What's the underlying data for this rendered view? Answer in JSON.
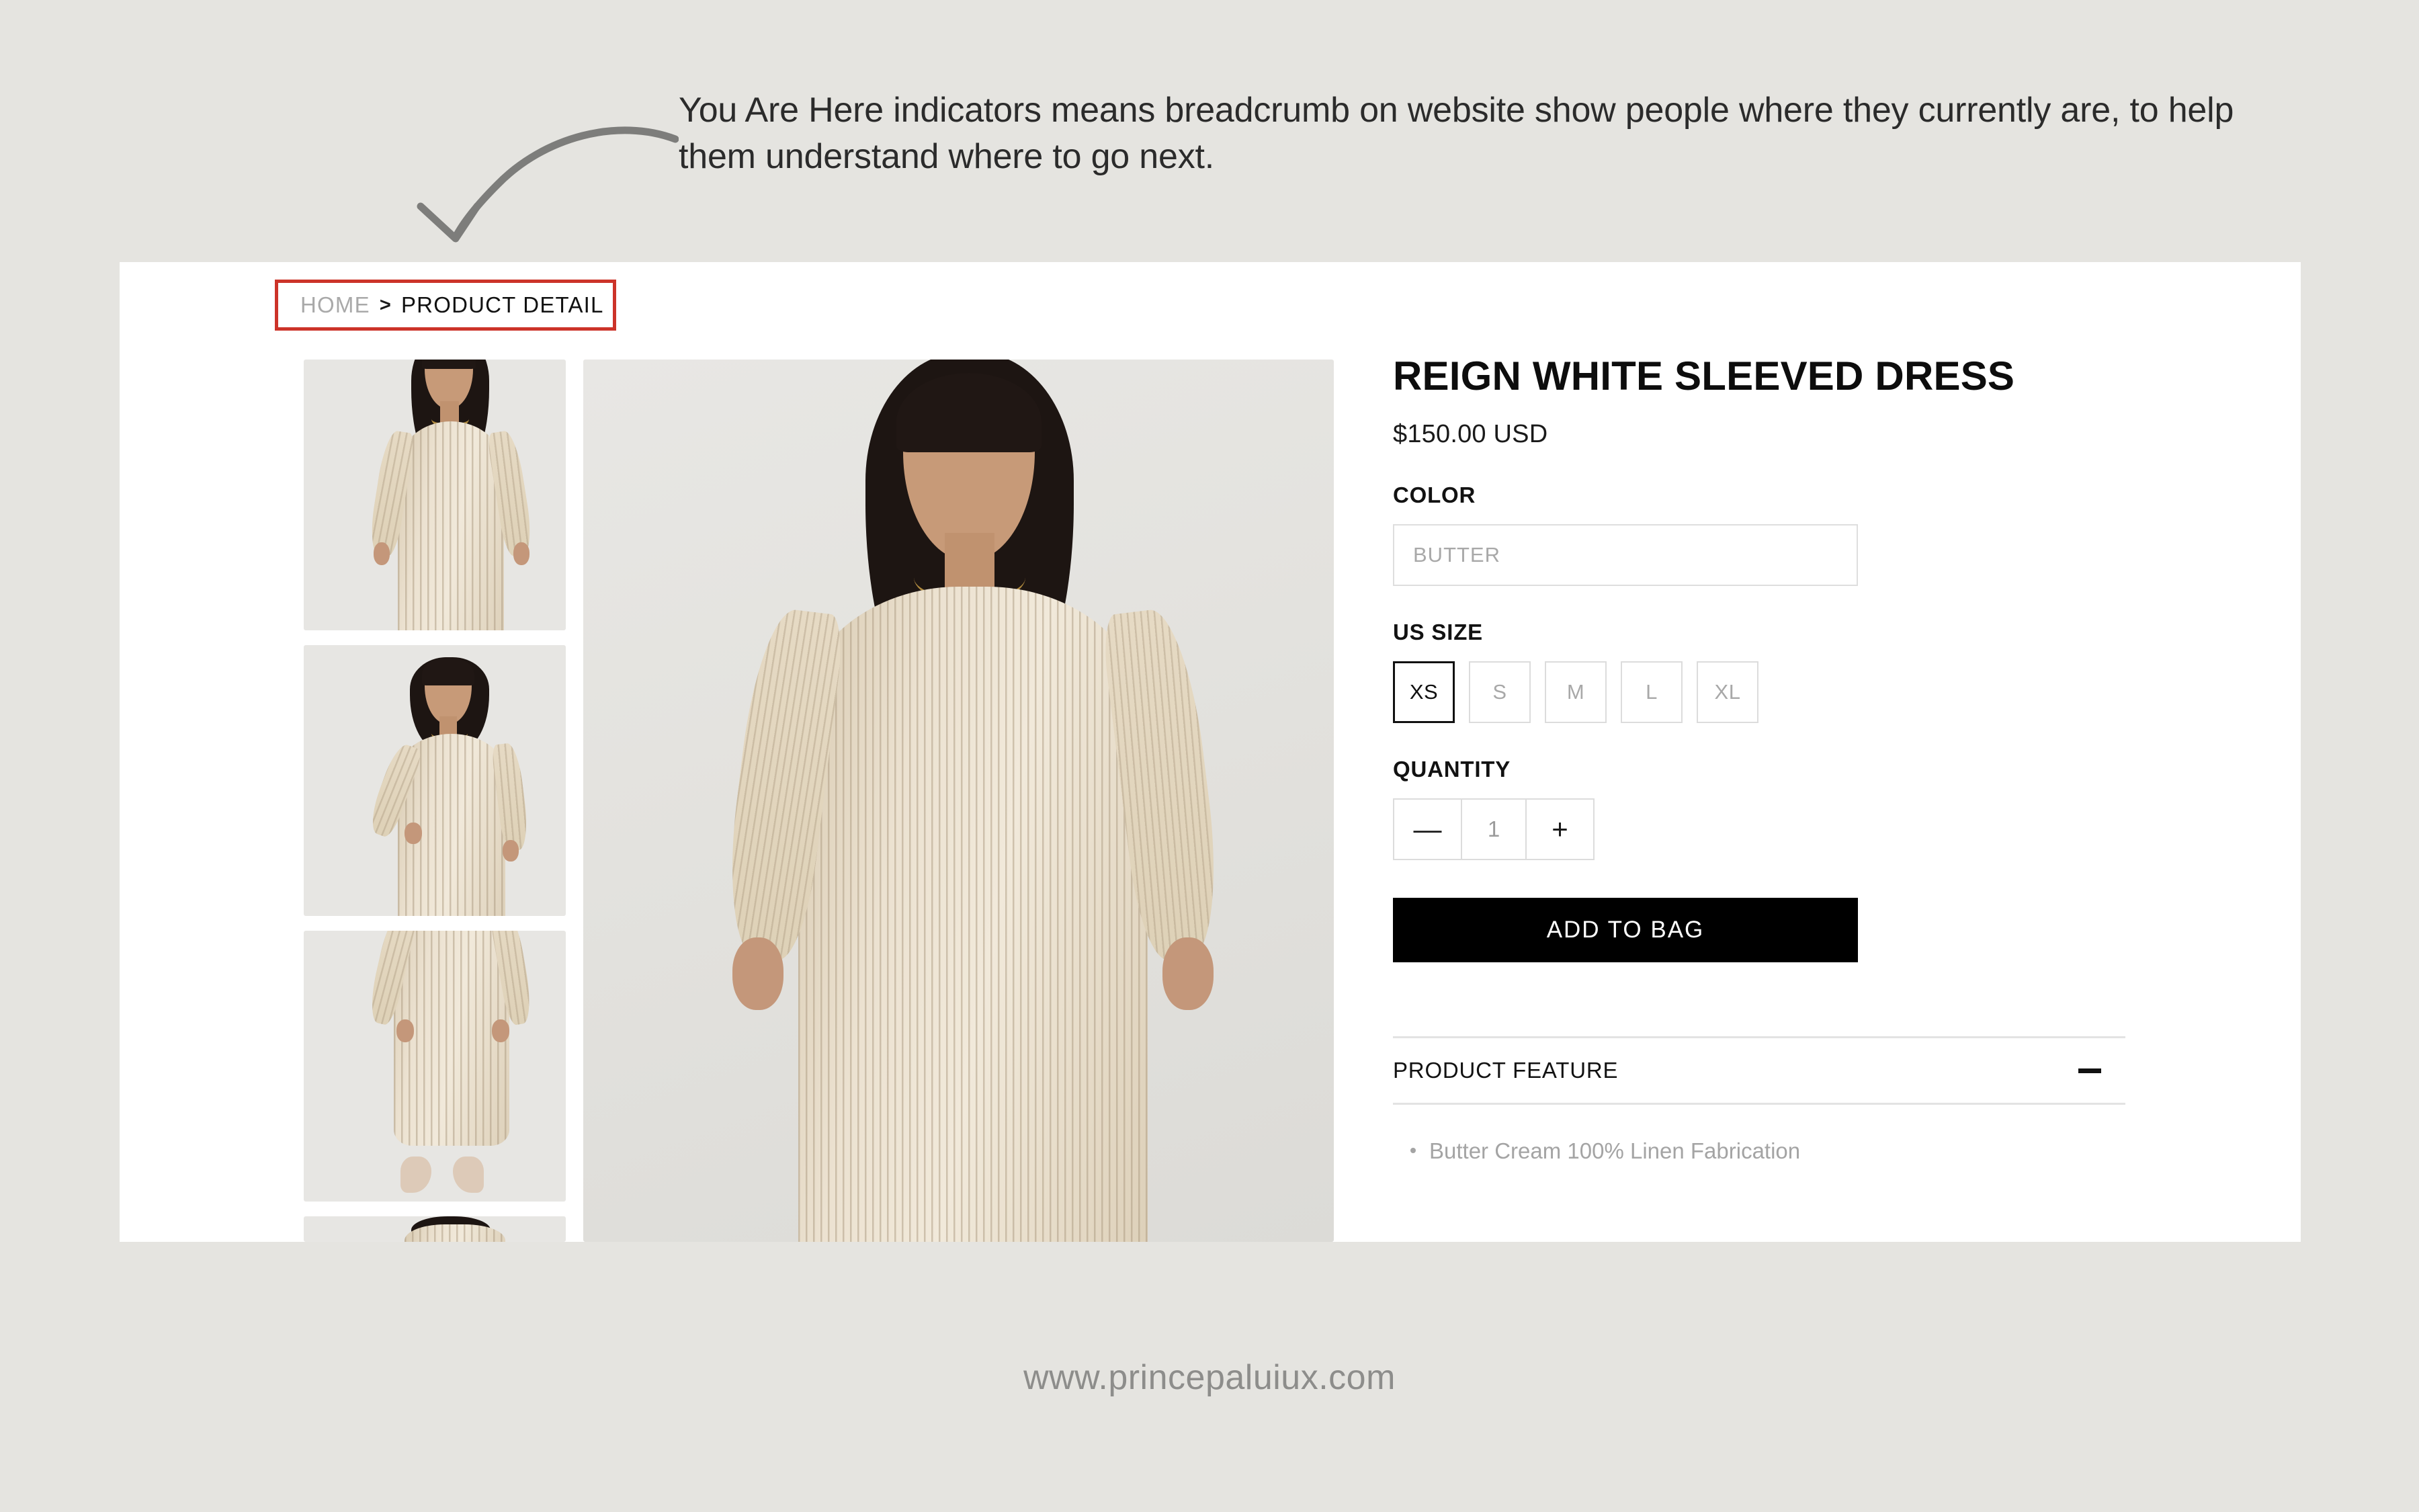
{
  "annotation": {
    "text": "You Are Here indicators means breadcrumb on website show people where they currently are, to help them understand where to go next.",
    "arrow_color": "#7d7d7b"
  },
  "highlight": {
    "color": "#cc3329"
  },
  "breadcrumb": {
    "home_label": "HOME",
    "separator": ">",
    "current_label": "PRODUCT DETAIL"
  },
  "gallery": {
    "thumbnails": [
      {
        "alt": "reign-white-sleeved-dress-front-bust"
      },
      {
        "alt": "reign-white-sleeved-dress-three-quarter"
      },
      {
        "alt": "reign-white-sleeved-dress-full-length"
      },
      {
        "alt": "reign-white-sleeved-dress-detail"
      }
    ],
    "hero_alt": "reign-white-sleeved-dress-hero"
  },
  "product": {
    "title": "REIGN WHITE SLEEVED DRESS",
    "price": "$150.00 USD",
    "color_label": "COLOR",
    "color_value": "BUTTER",
    "size_label": "US SIZE",
    "sizes": [
      {
        "label": "XS",
        "selected": true
      },
      {
        "label": "S",
        "selected": false
      },
      {
        "label": "M",
        "selected": false
      },
      {
        "label": "L",
        "selected": false
      },
      {
        "label": "XL",
        "selected": false
      }
    ],
    "quantity_label": "QUANTITY",
    "quantity_decrement": "—",
    "quantity_value": "1",
    "quantity_increment": "+",
    "add_to_bag_label": "ADD TO BAG"
  },
  "accordion": {
    "title": "PRODUCT FEATURE",
    "toggle_state": "expanded",
    "features": [
      "Butter Cream 100% Linen Fabrication"
    ]
  },
  "footer": {
    "url": "www.princepaluiux.com"
  }
}
